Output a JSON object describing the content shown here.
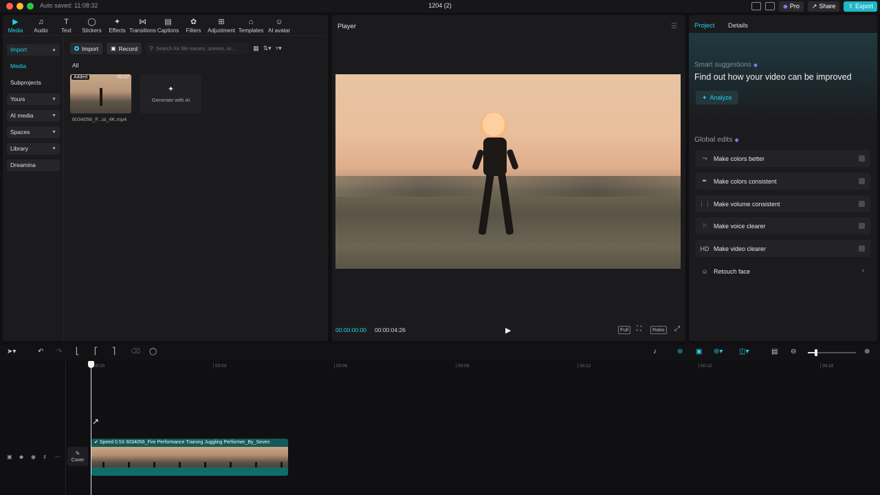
{
  "titlebar": {
    "autosave": "Auto saved: 11:08:32",
    "project_name": "1204 (2)",
    "pro_label": "Pro",
    "share_label": "Share",
    "export_label": "Export"
  },
  "toolbar": {
    "categories": [
      {
        "label": "Media",
        "icon": "media-icon",
        "active": true
      },
      {
        "label": "Audio",
        "icon": "audio-icon"
      },
      {
        "label": "Text",
        "icon": "text-icon"
      },
      {
        "label": "Stickers",
        "icon": "sticker-icon"
      },
      {
        "label": "Effects",
        "icon": "effects-icon"
      },
      {
        "label": "Transitions",
        "icon": "transition-icon"
      },
      {
        "label": "Captions",
        "icon": "captions-icon"
      },
      {
        "label": "Filters",
        "icon": "filter-icon"
      },
      {
        "label": "Adjustment",
        "icon": "adjustment-icon"
      },
      {
        "label": "Templates",
        "icon": "template-icon"
      },
      {
        "label": "AI avatar",
        "icon": "ai-avatar-icon"
      }
    ]
  },
  "sidebar": {
    "items": [
      {
        "label": "Import"
      },
      {
        "label": "Media"
      },
      {
        "label": "Subprojects"
      },
      {
        "label": "Yours"
      },
      {
        "label": "AI media"
      },
      {
        "label": "Spaces"
      },
      {
        "label": "Library"
      },
      {
        "label": "Dreamina"
      }
    ]
  },
  "media": {
    "import_label": "Import",
    "record_label": "Record",
    "search_placeholder": "Search for file names, scenes, or...",
    "filter_all": "All",
    "items": [
      {
        "badge": "Added",
        "duration": "00:07",
        "filename": "6034056_F...st_4K.mp4"
      }
    ],
    "generate_label": "Generate with AI"
  },
  "player": {
    "title": "Player",
    "current_time": "00:00:00:00",
    "total_time": "00:00:04:26",
    "full_label": "Full",
    "ratio_label": "Ratio"
  },
  "right_panel": {
    "tabs": [
      {
        "label": "Project",
        "active": true
      },
      {
        "label": "Details"
      }
    ],
    "smart_label": "Smart suggestions",
    "smart_title": "Find out how your video can be improved",
    "analyze_label": "Analyze",
    "global_label": "Global edits",
    "global_items": [
      {
        "label": "Make colors better",
        "icon": "magic-wand-icon"
      },
      {
        "label": "Make colors consistent",
        "icon": "color-dropper-icon"
      },
      {
        "label": "Make volume consistent",
        "icon": "sliders-icon"
      },
      {
        "label": "Make voice clearer",
        "icon": "waveform-icon"
      },
      {
        "label": "Make video clearer",
        "icon": "hd-icon",
        "icon_text": "HD"
      },
      {
        "label": "Retouch face",
        "icon": "face-icon"
      }
    ]
  },
  "timeline": {
    "ticks": [
      "00:00",
      "00:03",
      "00:06",
      "00:09",
      "00:12",
      "00:15",
      "00:18"
    ],
    "clip_label": "Speed 0.5X  6034056_Fire Performance Training Juggling Performer_By_Seven",
    "cover_label": "Cover"
  },
  "colors": {
    "accent": "#22d3e6",
    "panel": "#1b1b1e",
    "background": "#101012"
  }
}
